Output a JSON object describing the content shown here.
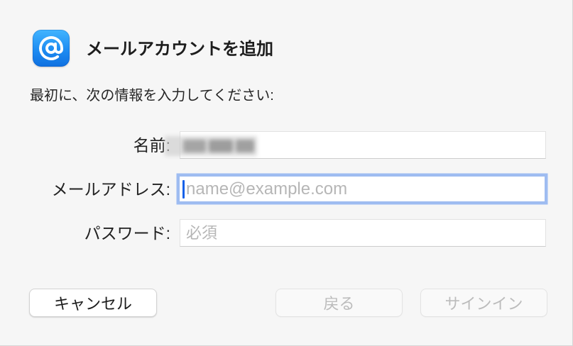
{
  "dialog": {
    "icon": "at-sign-icon",
    "title": "メールアカウントを追加",
    "instruction": "最初に、次の情報を入力してください:"
  },
  "form": {
    "name": {
      "label": "名前:"
    },
    "email": {
      "label": "メールアドレス:",
      "placeholder": "name@example.com",
      "focused": true
    },
    "password": {
      "label": "パスワード:",
      "placeholder": "必須"
    }
  },
  "buttons": {
    "cancel": {
      "label": "キャンセル",
      "enabled": true
    },
    "back": {
      "label": "戻る",
      "enabled": false
    },
    "sign_in": {
      "label": "サインイン",
      "enabled": false
    }
  },
  "colors": {
    "icon_blue": "#1e8cf2",
    "focus_ring": "#6898ee",
    "caret": "#1561e8",
    "disabled_text": "#bcbcbc",
    "background": "#f6f6f6"
  }
}
